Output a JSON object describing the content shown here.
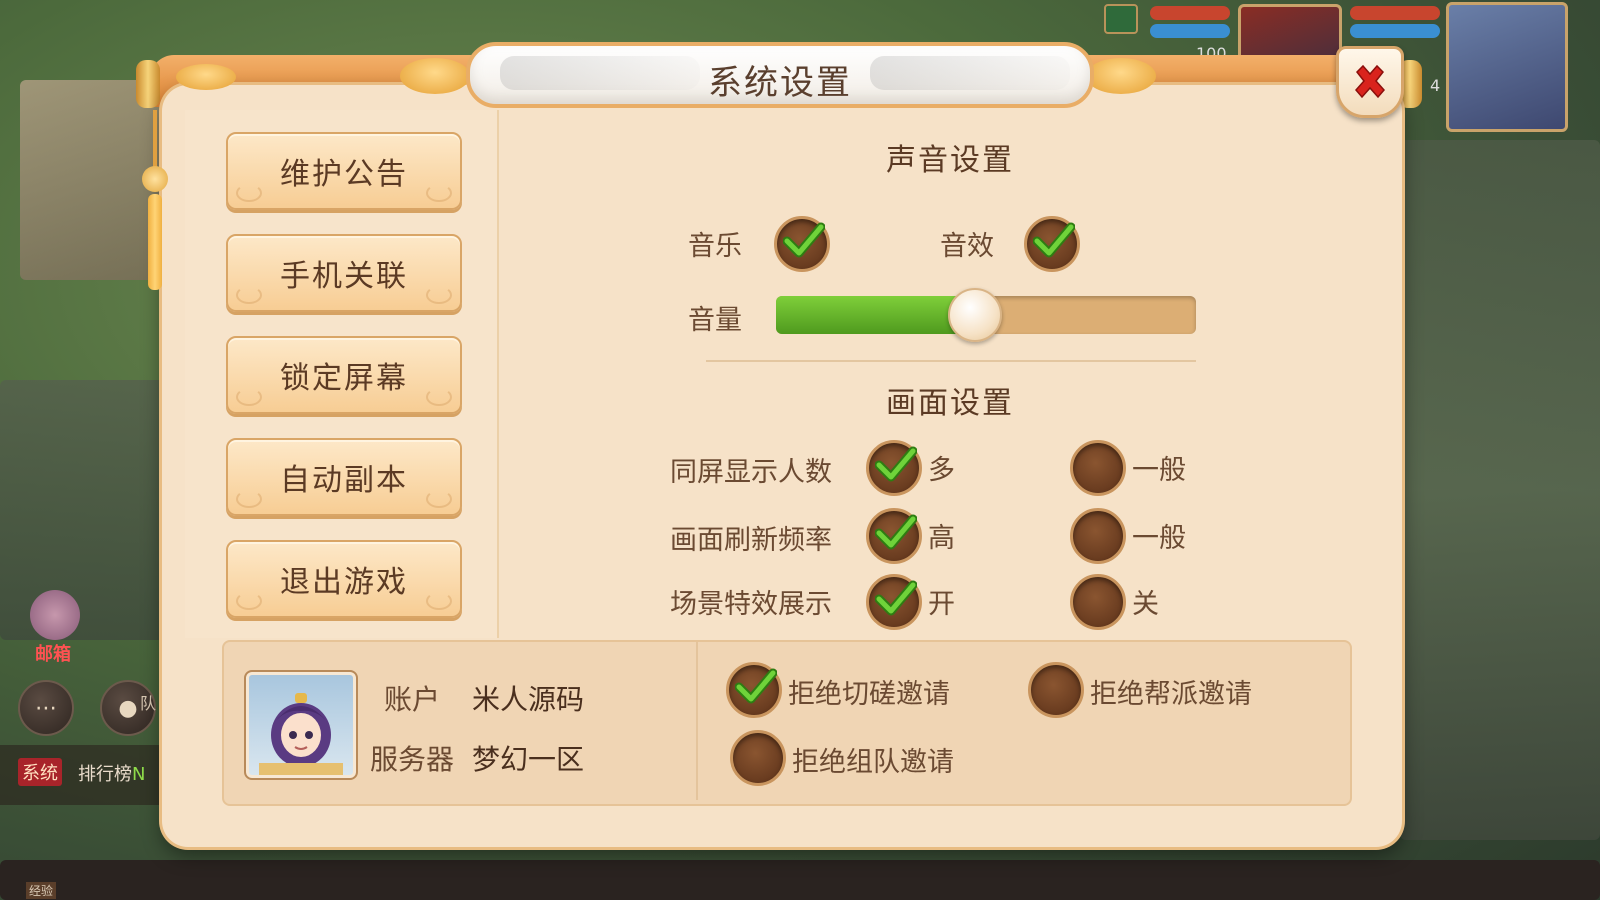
{
  "dialog": {
    "title": "系统设置",
    "close_icon": "close-icon"
  },
  "menu": {
    "items": [
      {
        "label": "维护公告"
      },
      {
        "label": "手机关联"
      },
      {
        "label": "锁定屏幕"
      },
      {
        "label": "自动副本"
      },
      {
        "label": "退出游戏"
      }
    ]
  },
  "sound": {
    "title": "声音设置",
    "music_label": "音乐",
    "music_on": true,
    "sfx_label": "音效",
    "sfx_on": true,
    "volume_label": "音量",
    "volume_level": 0.47
  },
  "display": {
    "title": "画面设置",
    "rows": [
      {
        "label": "同屏显示人数",
        "opt_a": "多",
        "opt_b": "一般",
        "selected": "a"
      },
      {
        "label": "画面刷新频率",
        "opt_a": "高",
        "opt_b": "一般",
        "selected": "a"
      },
      {
        "label": "场景特效展示",
        "opt_a": "开",
        "opt_b": "关",
        "selected": "a"
      }
    ]
  },
  "account": {
    "account_label": "账户",
    "account_value": "米人源码",
    "server_label": "服务器",
    "server_value": "梦幻一区"
  },
  "invites": {
    "reject_duel": "拒绝切磋邀请",
    "reject_duel_on": true,
    "reject_guild": "拒绝帮派邀请",
    "reject_guild_on": false,
    "reject_team": "拒绝组队邀请",
    "reject_team_on": false
  },
  "hud": {
    "level_num": "100",
    "side_num": "4",
    "mail_label": "邮箱",
    "team_label": "队",
    "chat_tag": "系统",
    "chat_text": "排行榜",
    "chat_text_tail": "N",
    "exp_label": "经验"
  },
  "colors": {
    "accent_green": "#5cb52a",
    "close_red": "#d9231d",
    "panel_bg": "#f6e2c8"
  }
}
